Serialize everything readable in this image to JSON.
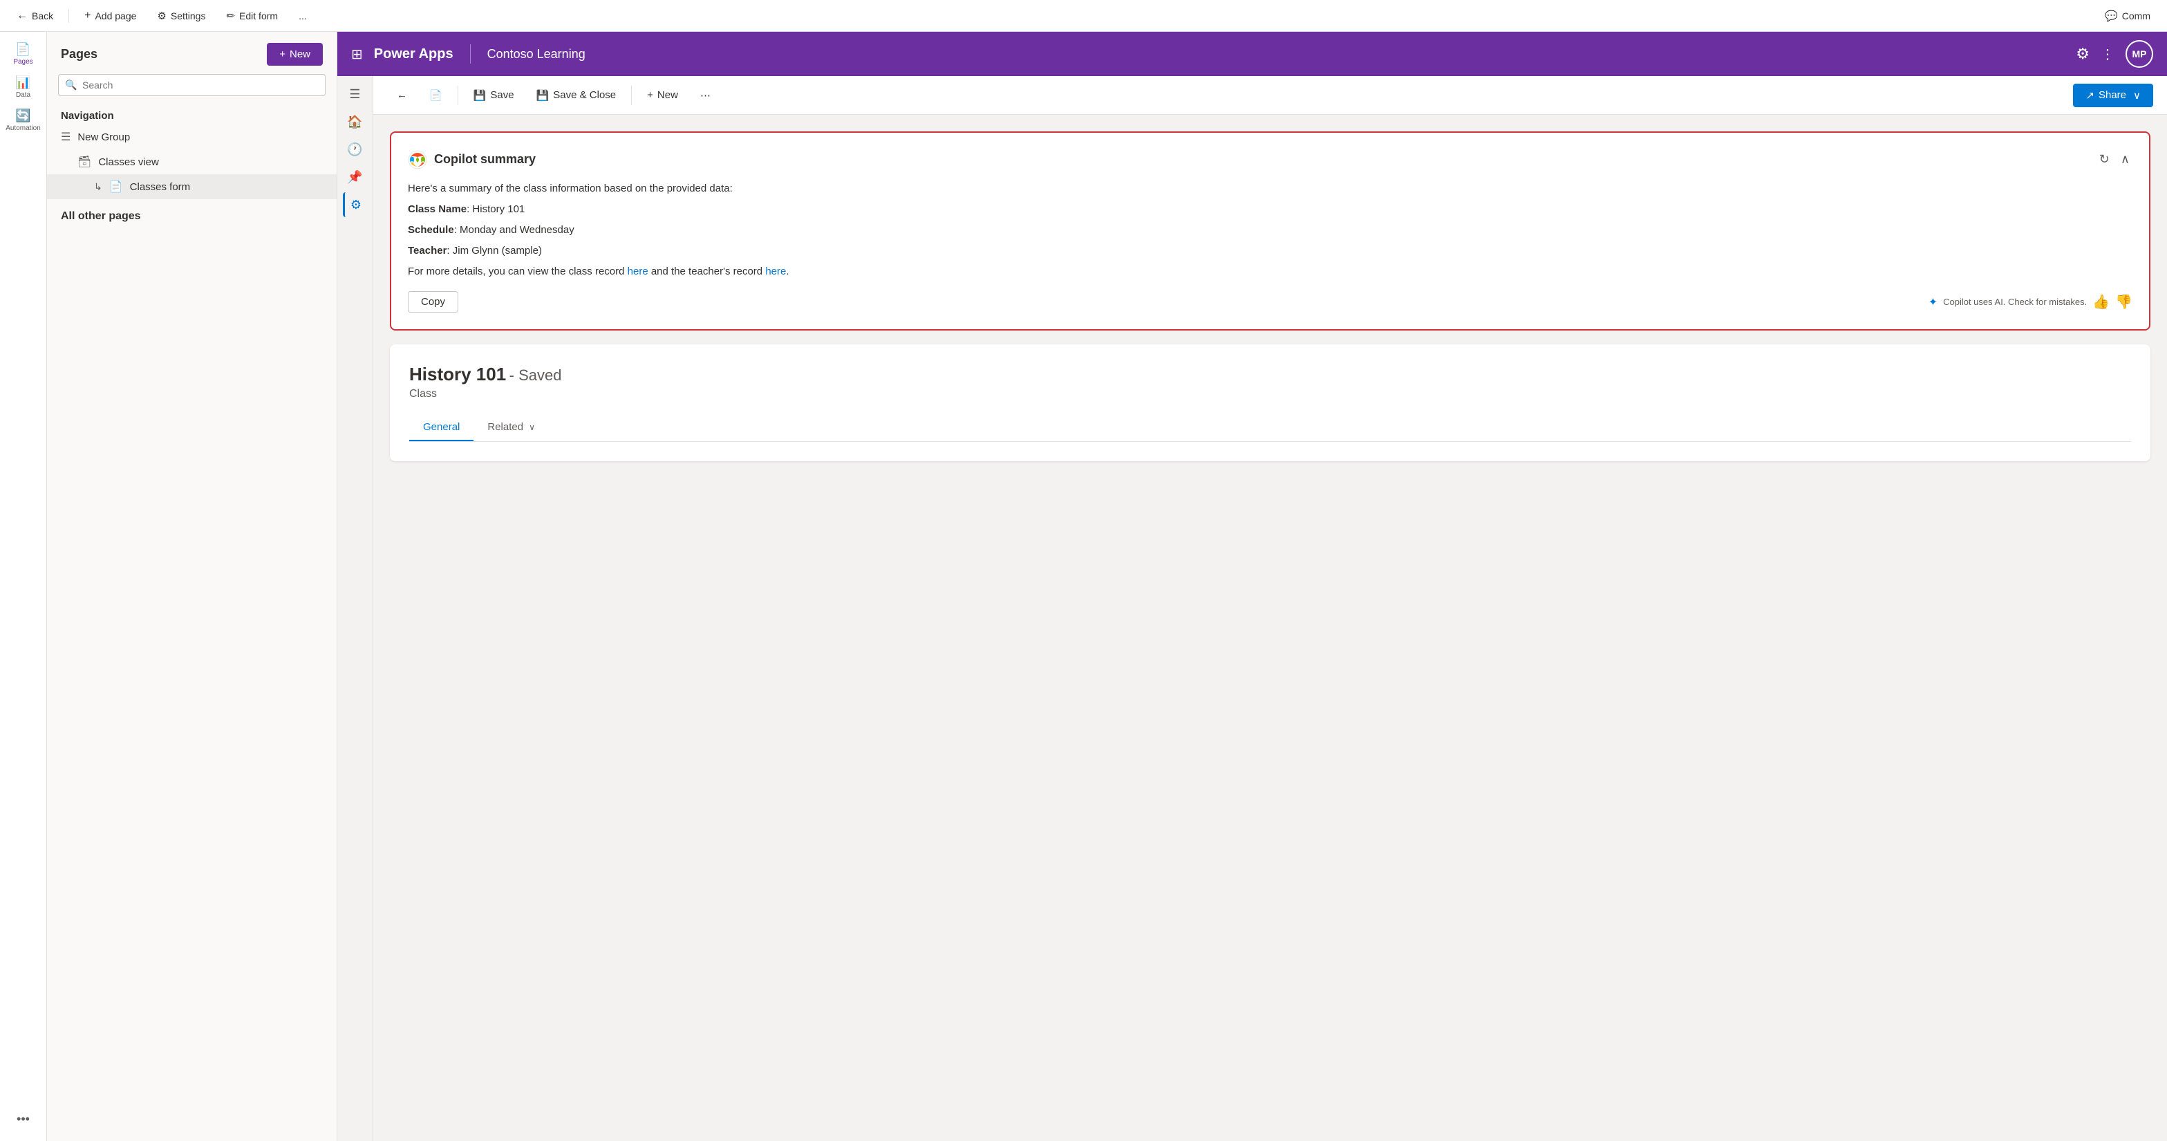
{
  "topBar": {
    "back_label": "Back",
    "add_page_label": "Add page",
    "settings_label": "Settings",
    "edit_form_label": "Edit form",
    "more_label": "..."
  },
  "pagesPanel": {
    "title": "Pages",
    "new_btn": "New",
    "search_placeholder": "Search",
    "nav_title": "Navigation",
    "nav_items": [
      {
        "label": "New Group",
        "icon": "☰"
      },
      {
        "label": "Classes view",
        "icon": "🗃",
        "indent": 1
      },
      {
        "label": "Classes form",
        "icon": "📄",
        "indent": 2,
        "active": true
      }
    ],
    "other_pages_title": "All other pages"
  },
  "header": {
    "app_grid_icon": "⊞",
    "app_name": "Power Apps",
    "site_name": "Contoso Learning",
    "gear_icon": "⚙",
    "more_icon": "⋮",
    "avatar_initials": "MP"
  },
  "toolbar": {
    "back_icon": "←",
    "document_icon": "📄",
    "save_label": "Save",
    "save_icon": "💾",
    "save_close_label": "Save & Close",
    "save_close_icon": "💾",
    "new_label": "New",
    "new_icon": "+",
    "more_icon": "⋯",
    "share_label": "Share",
    "share_icon": "↗",
    "share_chevron": "∨"
  },
  "copilot": {
    "title": "Copilot summary",
    "refresh_icon": "↻",
    "collapse_icon": "∧",
    "summary_intro": "Here's a summary of the class information based on the provided data:",
    "fields": [
      {
        "label": "Class Name",
        "value": ": History 101"
      },
      {
        "label": "Schedule",
        "value": ": Monday and Wednesday"
      },
      {
        "label": "Teacher",
        "value": ":  Jim Glynn (sample)"
      }
    ],
    "details_text": "For more details, you can view the class record ",
    "here1": "here",
    "and_text": " and the teacher's record ",
    "here2": "here",
    "period": ".",
    "copy_btn": "Copy",
    "disclaimer": "Copilot uses AI. Check for mistakes.",
    "thumbs_up": "👍",
    "thumbs_down": "👎"
  },
  "record": {
    "title": "History 101",
    "saved_label": "- Saved",
    "subtitle": "Class",
    "tabs": [
      {
        "label": "General",
        "active": true
      },
      {
        "label": "Related",
        "has_chevron": true
      }
    ]
  },
  "rightPanel": {
    "comm_label": "Comm"
  },
  "navIcons": [
    {
      "icon": "☰",
      "label": "menu-icon"
    },
    {
      "icon": "🏠",
      "label": "home-icon"
    },
    {
      "icon": "🕐",
      "label": "history-icon"
    },
    {
      "icon": "📌",
      "label": "pin-icon"
    },
    {
      "icon": "⚙",
      "label": "settings-icon",
      "active": true
    }
  ]
}
